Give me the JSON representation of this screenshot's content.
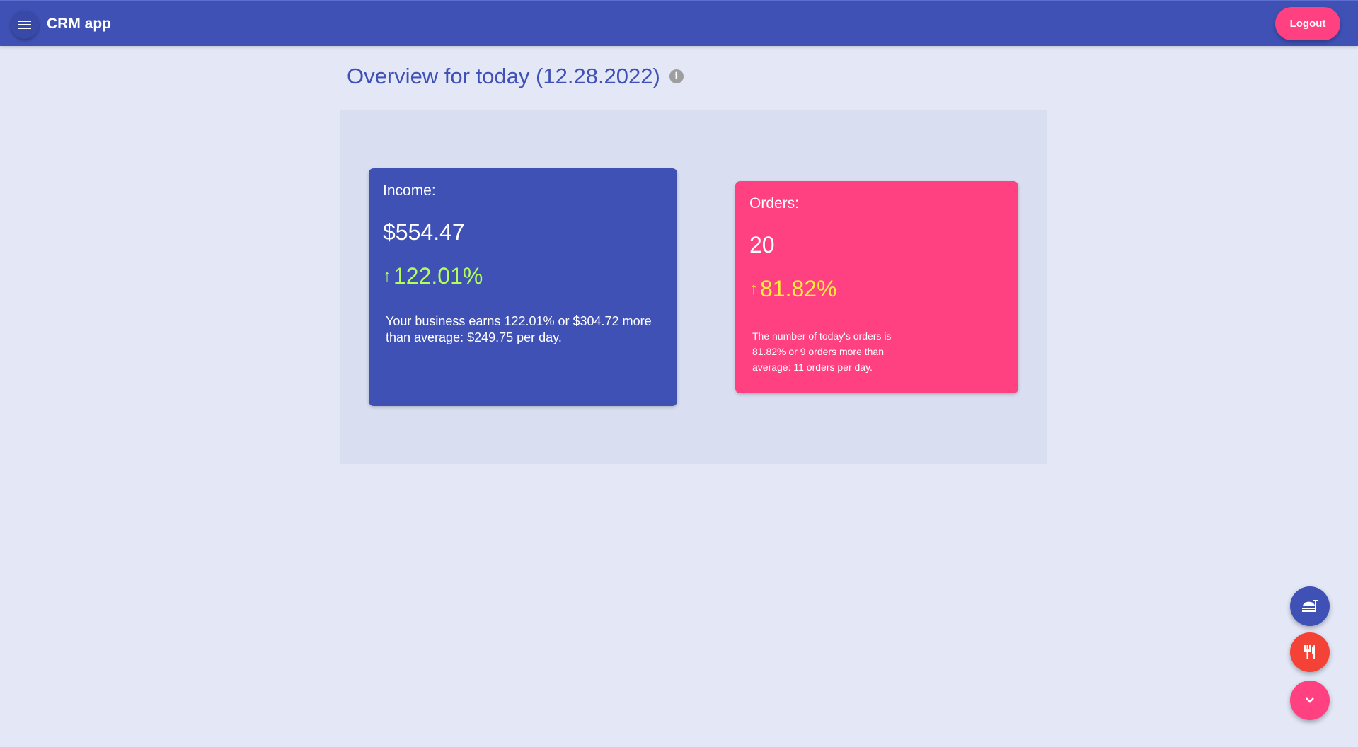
{
  "header": {
    "app_title": "CRM app",
    "logout_label": "Logout",
    "menu_icon": "menu-icon",
    "bar_color": "#3f51b5"
  },
  "page": {
    "title": "Overview for today (12.28.2022)",
    "info_icon": "info-icon",
    "info_glyph": "i"
  },
  "income": {
    "label": "Income:",
    "value": "$554.47",
    "change": "122.01%",
    "arrow_glyph": "↑",
    "description": "Your business earns 122.01% or $304.72 more than average: $249.75 per day.",
    "color": "#3f51b5",
    "change_color": "#b2ff59"
  },
  "orders": {
    "label": "Orders:",
    "value": "20",
    "change": "81.82%",
    "arrow_glyph": "↑",
    "description": "The number of today's orders is 81.82% or 9 orders more than average: 11 orders per day.",
    "color": "#ff4081",
    "change_color": "#ffeb3b"
  },
  "fab": {
    "actions": [
      {
        "icon": "fastfood-icon",
        "color": "#3f51b5"
      },
      {
        "icon": "restaurant-icon",
        "color": "#f44336"
      },
      {
        "icon": "chevron-down-icon",
        "color": "#ff4081"
      }
    ]
  }
}
